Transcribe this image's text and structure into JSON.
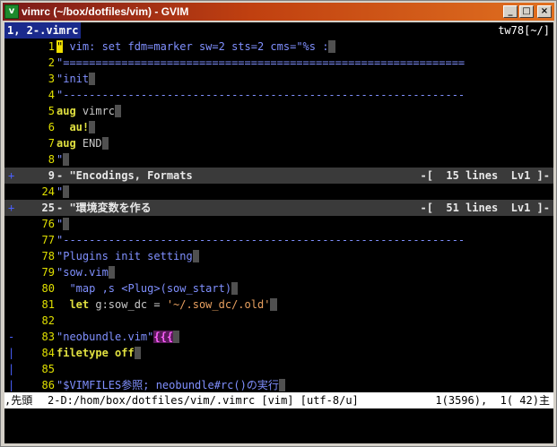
{
  "window": {
    "title": "vimrc (~/box/dotfiles/vim) - GVIM",
    "min_glyph": "_",
    "max_glyph": "□",
    "close_glyph": "×"
  },
  "tabline": {
    "active_tab": "1, 2-.vimrc",
    "cwd": "tw78[~/]"
  },
  "lines": [
    {
      "fold": "",
      "num": "1",
      "text": "\" vim: set fdm=marker sw=2 sts=2 cms=\"%s :"
    },
    {
      "fold": "",
      "num": "2",
      "text": "\"=============================================================="
    },
    {
      "fold": "",
      "num": "3",
      "text": "\"init"
    },
    {
      "fold": "",
      "num": "4",
      "text": "\"--------------------------------------------------------------"
    },
    {
      "fold": "",
      "num": "5",
      "text_kw": "aug",
      "text_rest": " vimrc"
    },
    {
      "fold": "",
      "num": "6",
      "text_kw": "  au!",
      "text_rest": ""
    },
    {
      "fold": "",
      "num": "7",
      "text_kw": "aug",
      "text_rest": " END"
    },
    {
      "fold": "",
      "num": "8",
      "text": "\""
    },
    {
      "fold": "+",
      "num": "9",
      "text": "- \"Encodings, Formats",
      "right": "-[  15 lines  Lv1 ]-"
    },
    {
      "fold": "",
      "num": "24",
      "text": "\""
    },
    {
      "fold": "+",
      "num": "25",
      "text": "- \"環境変数を作る",
      "right": "-[  51 lines  Lv1 ]-"
    },
    {
      "fold": "",
      "num": "76",
      "text": "\""
    },
    {
      "fold": "",
      "num": "77",
      "text": "\"--------------------------------------------------------------"
    },
    {
      "fold": "",
      "num": "78",
      "text": "\"Plugins init setting"
    },
    {
      "fold": "",
      "num": "79",
      "text": "\"sow.vim"
    },
    {
      "fold": "",
      "num": "80",
      "text": "  \"map ,s <Plug>(sow_start)"
    },
    {
      "fold": "",
      "num": "81",
      "text_kw": "  let",
      "text_rest": " g:sow_dc = ",
      "text_str": "'~/.sow_dc/.old'"
    },
    {
      "fold": "",
      "num": "82",
      "text": ""
    },
    {
      "fold": "-",
      "num": "83",
      "text": "\"neobundle.vim\"",
      "text_mark": "{{{"
    },
    {
      "fold": "|",
      "num": "84",
      "text_kw": "filetype",
      "text_rest": " ",
      "text_kw2": "off"
    },
    {
      "fold": "|",
      "num": "85",
      "text": ""
    },
    {
      "fold": "|",
      "num": "86",
      "text": "\"$VIMFILES参照; neobundle#rc()の実行"
    }
  ],
  "statusline": {
    "left": ",先頭",
    "file": "2-D:/hom/box/dotfiles/vim/.vimrc [vim] [utf-8/u]",
    "position": "1(3596),  1( 42)主"
  },
  "colors": {
    "tab_bg": "#1a2a8c",
    "comment": "#8090ff",
    "keyword": "#e0e040",
    "line_number": "#e0e000",
    "fold_bg": "#3a3a3a",
    "cursor": "#f0e000"
  }
}
